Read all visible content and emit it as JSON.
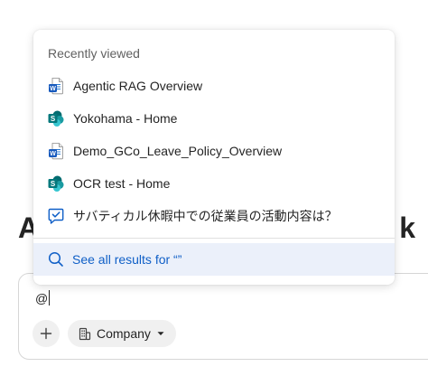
{
  "background": {
    "heading_start": "A",
    "heading_end": "k"
  },
  "popup": {
    "header": "Recently viewed",
    "items": [
      {
        "label": "Agentic RAG Overview",
        "icon": "word-doc-icon"
      },
      {
        "label": "Yokohama - Home",
        "icon": "sharepoint-icon"
      },
      {
        "label": "Demo_GCo_Leave_Policy_Overview",
        "icon": "word-doc-icon"
      },
      {
        "label": "OCR test - Home",
        "icon": "sharepoint-icon"
      },
      {
        "label": "サバティカル休暇中での従業員の活動内容は？",
        "icon": "task-chat-icon"
      }
    ],
    "see_all": "See all results for “”"
  },
  "composer": {
    "input_value": "@",
    "scope_label": "Company"
  },
  "colors": {
    "accent": "#0f5fc7",
    "highlight": "#ebf0fa",
    "word_blue": "#185abd",
    "sharepoint_teal": "#038387"
  }
}
